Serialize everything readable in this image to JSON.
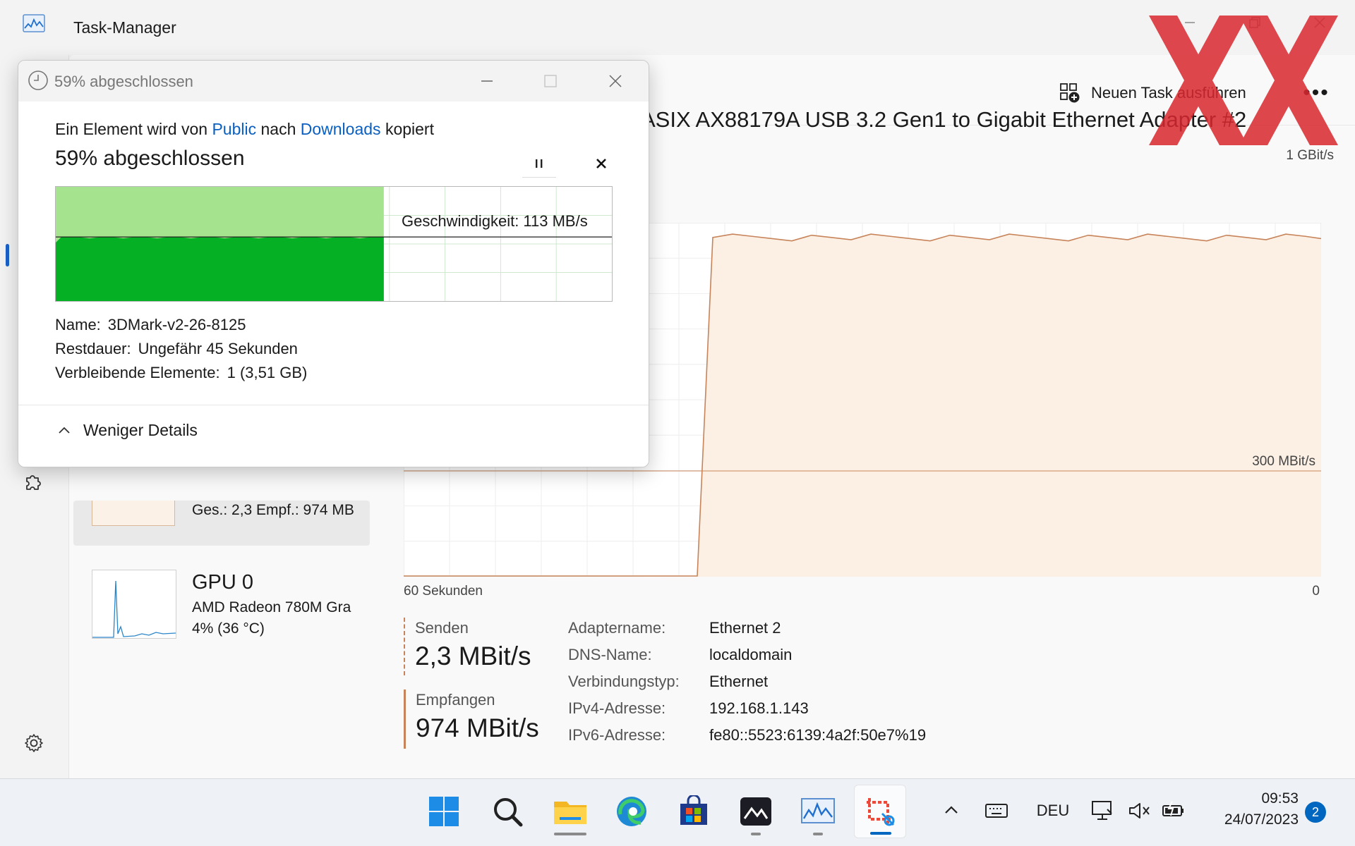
{
  "taskmanager": {
    "title": "Task-Manager",
    "run_task_label": "Neuen Task ausführen",
    "more_label": "•••"
  },
  "perf_list": {
    "ethernet_sub": "Ges.: 2,3  Empf.: 974 MB",
    "gpu_name": "GPU 0",
    "gpu_model": "AMD Radeon 780M Gra",
    "gpu_usage": "4% (36 °C)"
  },
  "detail": {
    "adapter_title": "ASIX AX88179A USB 3.2 Gen1 to Gigabit Ethernet Adapter #2",
    "graph_max_label": "1 GBit/s",
    "graph_mid_label": "300 MBit/s",
    "graph_time_label": "60 Sekunden",
    "graph_zero_label": "0",
    "send_label": "Senden",
    "send_value": "2,3 MBit/s",
    "recv_label": "Empfangen",
    "recv_value": "974 MBit/s",
    "properties": [
      {
        "key": "Adaptername:",
        "value": "Ethernet 2"
      },
      {
        "key": "DNS-Name:",
        "value": "localdomain"
      },
      {
        "key": "Verbindungstyp:",
        "value": "Ethernet"
      },
      {
        "key": "IPv4-Adresse:",
        "value": "192.168.1.143"
      },
      {
        "key": "IPv6-Adresse:",
        "value": "fe80::5523:6139:4a2f:50e7%19"
      }
    ],
    "throughput_trace": {
      "note_units": "fraction of 1 GBit/s scale across 60 seconds",
      "leading_zero_fraction": 0.32,
      "level": 0.974
    }
  },
  "copy_dialog": {
    "title": "59% abgeschlossen",
    "copy_prefix": "Ein Element wird von",
    "source": "Public",
    "middle": "nach",
    "destination": "Downloads",
    "suffix": "kopiert",
    "percent_label": "59% abgeschlossen",
    "progress": 0.59,
    "speed_label": "Geschwindigkeit: 113 MB/s",
    "name_key": "Name:",
    "name_value": "3DMark-v2-26-8125",
    "remaining_key": "Restdauer:",
    "remaining_value": "Ungefähr 45 Sekunden",
    "items_key": "Verbleibende Elemente:",
    "items_value": "1 (3,51 GB)",
    "less_details": "Weniger Details"
  },
  "taskbar": {
    "language": "DEU",
    "time": "09:53",
    "date": "24/07/2023",
    "notification_count": "2",
    "apps": [
      "windows-start",
      "search",
      "file-explorer",
      "edge",
      "store",
      "mail",
      "task-manager",
      "snipping-tool"
    ]
  },
  "colors": {
    "accent": "#0067c0",
    "network_line": "#c7845a",
    "network_fill": "#fcefe3",
    "progress_green": "#06b025",
    "progress_light": "#a6e38e",
    "watermark_red": "#d9282f"
  }
}
